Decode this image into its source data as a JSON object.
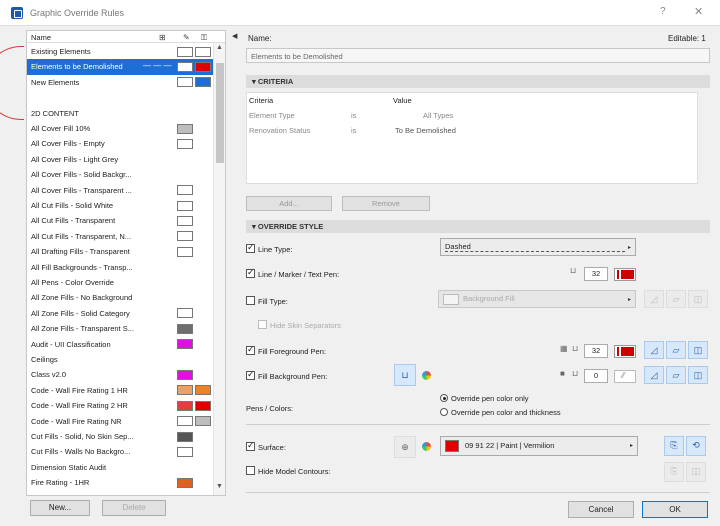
{
  "window": {
    "title": "Graphic Override Rules",
    "help_glyph": "?",
    "close_glyph": "✕"
  },
  "list": {
    "header": {
      "name": "Name"
    },
    "items": [
      {
        "label": "Existing Elements",
        "swatches": [
          "#ffffff",
          "#ffffff"
        ]
      },
      {
        "label": "Elements to be Demolished",
        "selected": true,
        "dashes": "— — —",
        "swatches": [
          "#ffffff",
          "#e00000"
        ]
      },
      {
        "label": "New Elements",
        "swatches": [
          "#ffffff",
          "#1e6fd0"
        ]
      },
      {
        "label": ""
      },
      {
        "label": "2D CONTENT"
      },
      {
        "label": "All Cover Fill 10%",
        "swatches": [
          "#bdbdbd"
        ]
      },
      {
        "label": "All Cover Fills - Empty",
        "swatches": [
          "#ffffff"
        ]
      },
      {
        "label": "All Cover Fills - Light Grey"
      },
      {
        "label": "All Cover Fills - Solid Backgr..."
      },
      {
        "label": "All Cover Fills - Transparent ...",
        "swatches": [
          "#ffffff"
        ]
      },
      {
        "label": "All Cut Fills - Solid White",
        "swatches": [
          "#ffffff"
        ]
      },
      {
        "label": "All Cut Fills - Transparent",
        "swatches": [
          "#ffffff"
        ]
      },
      {
        "label": "All Cut Fills - Transparent, N...",
        "swatches": [
          "#ffffff"
        ]
      },
      {
        "label": "All Drafting Fills - Transparent",
        "swatches": [
          "#ffffff"
        ]
      },
      {
        "label": "All Fill Backgrounds - Transp..."
      },
      {
        "label": "All Pens - Color Override"
      },
      {
        "label": "All Zone Fills - No Background"
      },
      {
        "label": "All Zone Fills - Solid Category",
        "swatches": [
          "#ffffff"
        ]
      },
      {
        "label": "All Zone Fills - Transparent S...",
        "swatches": [
          "#6e6e6e"
        ]
      },
      {
        "label": "Audit - UII Classification",
        "swatches": [
          "#e010e0"
        ]
      },
      {
        "label": "Ceilings"
      },
      {
        "label": "Class v2.0",
        "swatches": [
          "#e010e0"
        ]
      },
      {
        "label": "Code - Wall Fire Rating 1 HR",
        "swatches": [
          "#f0a060",
          "#f08020"
        ]
      },
      {
        "label": "Code - Wall Fire Rating 2 HR",
        "swatches": [
          "#e04040",
          "#e00000"
        ]
      },
      {
        "label": "Code - Wall Fire Rating NR",
        "swatches": [
          "#ffffff",
          "#bdbdbd"
        ]
      },
      {
        "label": "Cut Fills - Solid, No Skin Sep...",
        "swatches": [
          "#555555"
        ]
      },
      {
        "label": "Cut Fills - Walls No Backgro...",
        "swatches": [
          "#ffffff"
        ]
      },
      {
        "label": "Dimension Static Audit"
      },
      {
        "label": "Fire Rating - 1HR",
        "swatches": [
          "#e06020"
        ]
      }
    ],
    "new_button": "New...",
    "delete_button": "Delete"
  },
  "detail": {
    "name_label": "Name:",
    "editable": "Editable: 1",
    "name_value": "Elements to be Demolished",
    "criteria": {
      "title": "CRITERIA",
      "col_criteria": "Criteria",
      "col_value": "Value",
      "rows": [
        {
          "criteria": "Element Type",
          "op": "is",
          "value": "All Types"
        },
        {
          "criteria": "Renovation Status",
          "op": "is",
          "value": "To Be Demolished"
        }
      ],
      "add_button": "Add...",
      "remove_button": "Remove"
    },
    "override": {
      "title": "OVERRIDE STYLE",
      "line_type_label": "Line Type:",
      "line_type_value": "Dashed",
      "line_pen_label": "Line / Marker / Text Pen:",
      "line_pen_value": "32",
      "fill_type_label": "Fill Type:",
      "fill_type_value": "Background Fill",
      "hide_skin_label": "Hide Skin Separators",
      "fill_fg_label": "Fill Foreground Pen:",
      "fill_fg_value": "32",
      "fill_bg_label": "Fill Background Pen:",
      "fill_bg_value": "0",
      "pens_colors_label": "Pens / Colors:",
      "radio_only": "Override pen color only",
      "radio_thickness": "Override pen color and thickness",
      "surface_label": "Surface:",
      "surface_value": "09 91 22 | Paint | Vermilion",
      "surface_color": "#e00000",
      "hide_contours_label": "Hide Model Contours:"
    },
    "cancel_button": "Cancel",
    "ok_button": "OK"
  }
}
